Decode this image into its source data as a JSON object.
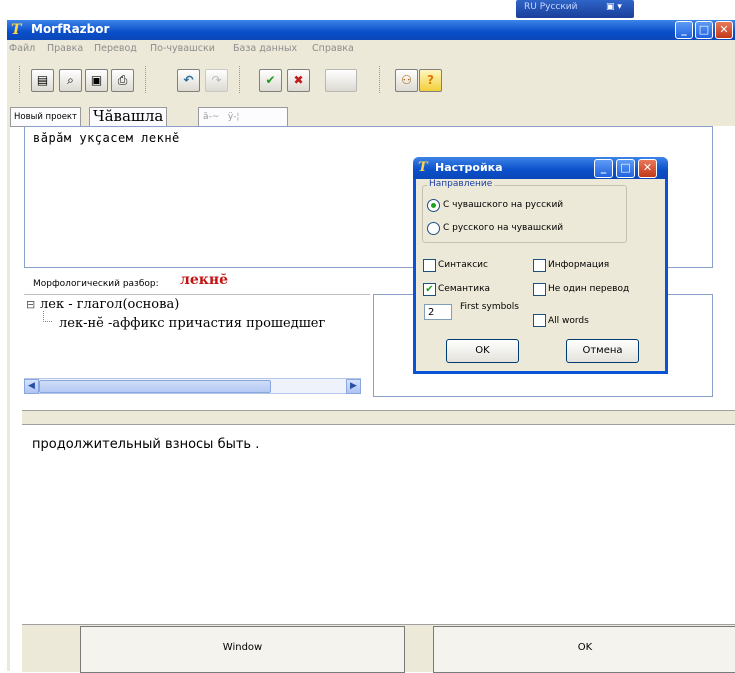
{
  "language_bar": {
    "label": "RU Русский"
  },
  "window": {
    "title": "MorfRazbor",
    "icon": "T"
  },
  "menu": [
    "Файл",
    "Правка",
    "Перевод",
    "По-чувашски",
    "База данных",
    "Справка"
  ],
  "toolbar": {
    "icons": [
      "page-icon",
      "open-folder-icon",
      "save-disk-icon",
      "print-icon",
      "undo-icon",
      "redo-icon",
      "check-icon",
      "cross-icon",
      "blank-button",
      "users-icon",
      "help-icon"
    ],
    "glyphs": {
      "page": "▤",
      "open": "⌕",
      "save": "▣",
      "print": "⎙",
      "undo": "↶",
      "redo": "↷",
      "check": "✔",
      "cross": "✖",
      "users": "⚇",
      "help": "?"
    }
  },
  "tabs": {
    "new_project": "Новый проект",
    "chuvash": "Чăвашла",
    "t3": "ă-~",
    "t4": "ÿ-¦"
  },
  "input": {
    "text": "вăрăм укçасем лекнĕ"
  },
  "morph": {
    "label": "Морфологический разбор:",
    "word": "лекнĕ",
    "tree_root": "лек - глагол(основа)",
    "tree_child": "лек-нĕ -аффикс причастия прошедшег"
  },
  "output": {
    "text": "продолжительный взносы быть ."
  },
  "buttons": {
    "window": "Window",
    "ok": "OK"
  },
  "dialog": {
    "title": "Настройка",
    "icon": "T",
    "group_label": "Направление",
    "radio1": "С чувашского на русский",
    "radio2": "С русского на чувашский",
    "radio1_selected": true,
    "chk_syntax": "Синтаксис",
    "chk_info": "Информация",
    "chk_semantics": "Семантика",
    "chk_multi": "Не один перевод",
    "semantics_checked": true,
    "first_symbols_value": "2",
    "first_symbols_label": "First symbols",
    "chk_allwords": "All words",
    "ok": "OK",
    "cancel": "Отмена"
  },
  "colors": {
    "titlebar": "#0a4fc9",
    "morph_word": "#c31212",
    "check": "#21a121"
  }
}
